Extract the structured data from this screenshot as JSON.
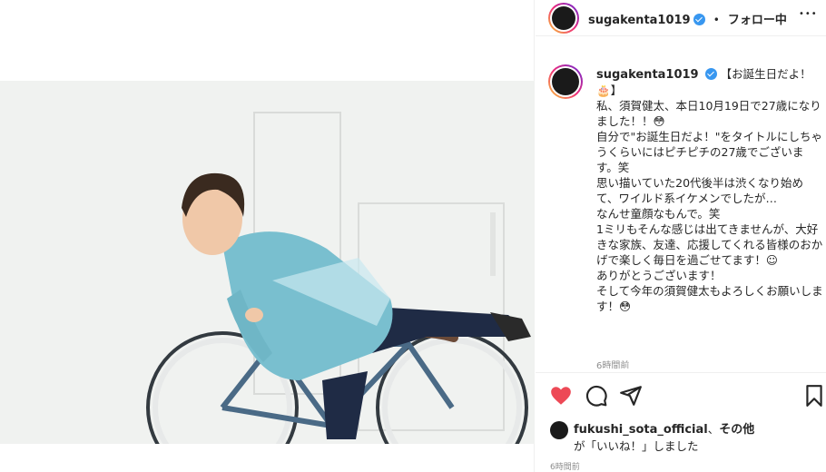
{
  "post": {
    "username": "sugakenta1019",
    "follow_separator": "•",
    "follow_label": "フォロー中",
    "more_label": "•••"
  },
  "caption": {
    "username": "sugakenta1019",
    "text": "【お誕生日だよ！🎂】\n私、須賀健太、本日10月19日で27歳になりました！！😳\n自分で\"お誕生日だよ！\"をタイトルにしちゃうくらいにはピチピチの27歳でございます。笑\n思い描いていた20代後半は渋くなり始めて、ワイルド系イケメンでしたが…\nなんせ童顔なもんで。笑\n1ミリもそんな感じは出てきませんが、大好きな家族、友達、応援してくれる皆様のおかげで楽しく毎日を過ごせてます！☺\nありがとうございます！\nそして今年の須賀健太もよろしくお願いします！😳",
    "time_ago": "6時間前"
  },
  "actions": {
    "like_icon": "heart-filled-icon",
    "comment_icon": "comment-icon",
    "share_icon": "paper-plane-icon",
    "save_icon": "bookmark-icon",
    "like_color": "#ed4956"
  },
  "likes": {
    "username": "fukushi_sota_official",
    "sep": "、",
    "others": "その他",
    "text": "が「いいね！」しました",
    "time_ago": "6時間前"
  }
}
